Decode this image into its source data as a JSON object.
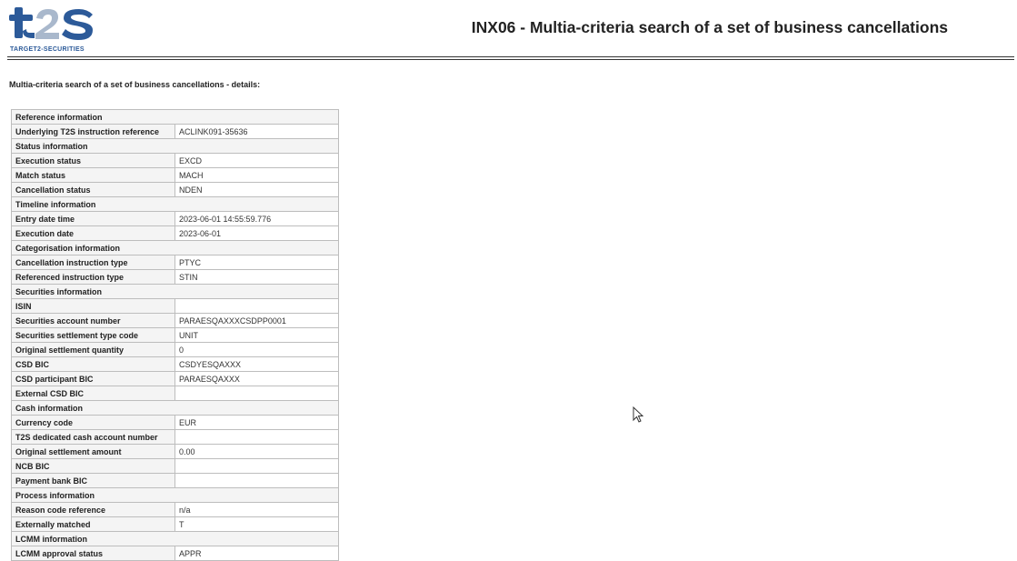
{
  "header": {
    "logo_text": "t2s",
    "logo_subtitle": "TARGET2-SECURITIES",
    "title": "INX06 - Multia-criteria search of a set of business cancellations"
  },
  "subtitle": "Multia-criteria search of a set of business cancellations - details:",
  "details": {
    "reference": {
      "heading": "Reference information",
      "underlying_ref": {
        "label": "Underlying T2S instruction reference",
        "value": "ACLINK091-35636"
      }
    },
    "status": {
      "heading": "Status information",
      "execution": {
        "label": "Execution status",
        "value": "EXCD"
      },
      "match": {
        "label": "Match status",
        "value": "MACH"
      },
      "cancellation": {
        "label": "Cancellation status",
        "value": "NDEN"
      }
    },
    "timeline": {
      "heading": "Timeline information",
      "entry_datetime": {
        "label": "Entry date time",
        "value": "2023-06-01 14:55:59.776"
      },
      "execution_date": {
        "label": "Execution date",
        "value": "2023-06-01"
      }
    },
    "categorisation": {
      "heading": "Categorisation information",
      "cancellation_type": {
        "label": "Cancellation instruction type",
        "value": "PTYC"
      },
      "referenced_type": {
        "label": "Referenced instruction type",
        "value": "STIN"
      }
    },
    "securities": {
      "heading": "Securities information",
      "isin": {
        "label": "ISIN",
        "value": ""
      },
      "account_number": {
        "label": "Securities account number",
        "value": "PARAESQAXXXCSDPP0001"
      },
      "settlement_type_code": {
        "label": "Securities settlement type code",
        "value": "UNIT"
      },
      "original_quantity": {
        "label": "Original settlement quantity",
        "value": "0"
      },
      "csd_bic": {
        "label": "CSD BIC",
        "value": "CSDYESQAXXX"
      },
      "participant_bic": {
        "label": "CSD participant BIC",
        "value": "PARAESQAXXX"
      },
      "external_csd_bic": {
        "label": "External CSD BIC",
        "value": ""
      }
    },
    "cash": {
      "heading": "Cash information",
      "currency": {
        "label": "Currency code",
        "value": "EUR"
      },
      "dedicated_account": {
        "label": "T2S dedicated cash account number",
        "value": ""
      },
      "original_amount": {
        "label": "Original settlement amount",
        "value": "0.00"
      },
      "ncb_bic": {
        "label": "NCB BIC",
        "value": ""
      },
      "payment_bank_bic": {
        "label": "Payment bank BIC",
        "value": ""
      }
    },
    "process": {
      "heading": "Process information",
      "reason_code": {
        "label": "Reason code reference",
        "value": "n/a"
      },
      "externally_matched": {
        "label": "Externally matched",
        "value": "T"
      }
    },
    "lcmm": {
      "heading": "LCMM information",
      "approval_status": {
        "label": "LCMM approval status",
        "value": "APPR"
      }
    }
  },
  "colors": {
    "logo_blue": "#2c5a99",
    "logo_grey": "#a9b8cc",
    "border": "#bdbdbd",
    "label_bg": "#f4f4f4"
  },
  "icons": {
    "cursor": "mouse-pointer-icon"
  }
}
